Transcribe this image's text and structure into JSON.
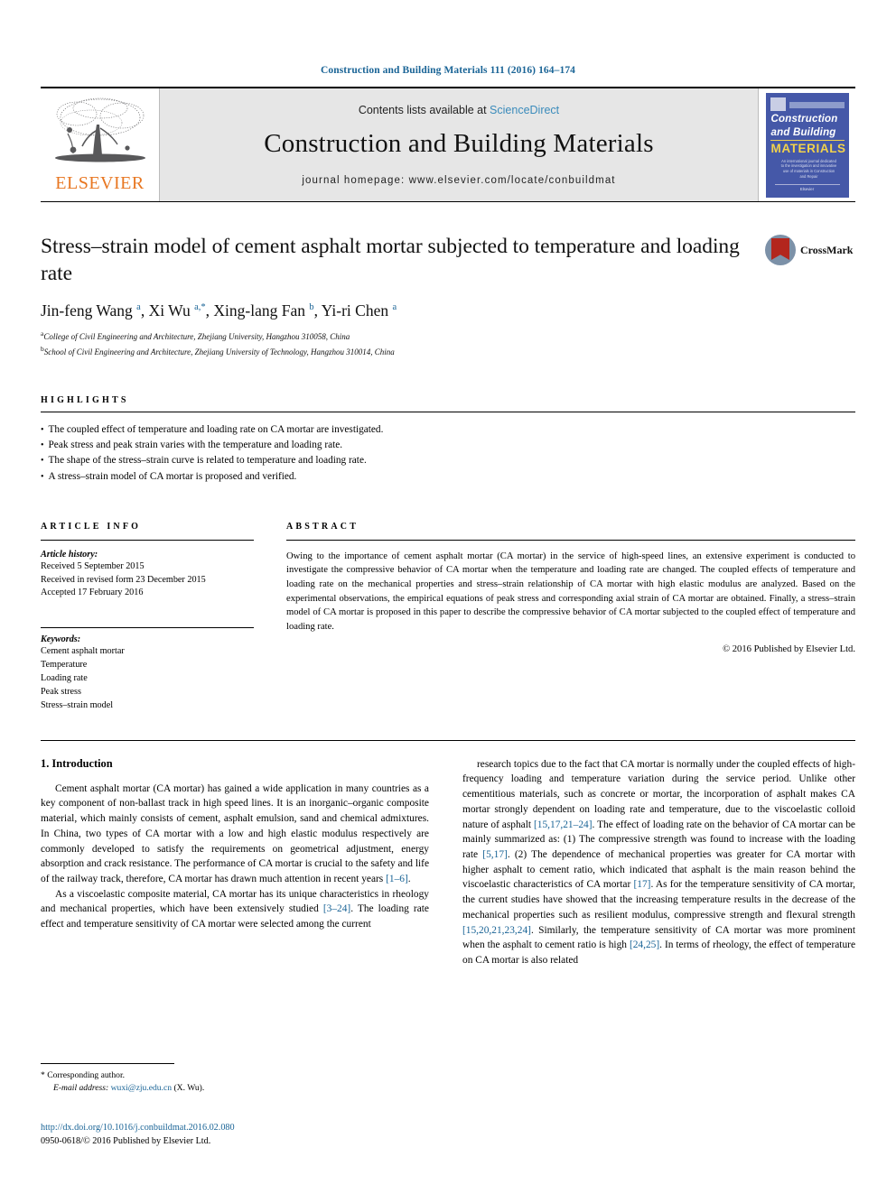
{
  "running_head": "Construction and Building Materials 111 (2016) 164–174",
  "masthead": {
    "publisher_name": "ELSEVIER",
    "contents_prefix": "Contents lists available at ",
    "contents_link": "ScienceDirect",
    "journal_title": "Construction and Building Materials",
    "journal_homepage": "journal homepage: www.elsevier.com/locate/conbuildmat",
    "cover": {
      "line1": "Construction",
      "line2": "and Building",
      "line3": "MATERIALS",
      "subtitle": "An international journal dedicated to the investigation and innovative use of materials in Construction and Repair",
      "footer": "Elsevier"
    }
  },
  "article": {
    "title": "Stress–strain model of cement asphalt mortar subjected to temperature and loading rate",
    "crossmark_label": "CrossMark",
    "authors_html": "Jin-feng Wang <sup>a</sup>, Xi Wu <sup>a,*</sup>, Xing-lang Fan <sup>b</sup>, Yi-ri Chen <sup>a</sup>",
    "affiliations": [
      "College of Civil Engineering and Architecture, Zhejiang University, Hangzhou 310058, China",
      "School of Civil Engineering and Architecture, Zhejiang University of Technology, Hangzhou 310014, China"
    ],
    "affiliation_markers": [
      "a",
      "b"
    ]
  },
  "highlights": {
    "label": "HIGHLIGHTS",
    "items": [
      "The coupled effect of temperature and loading rate on CA mortar are investigated.",
      "Peak stress and peak strain varies with the temperature and loading rate.",
      "The shape of the stress–strain curve is related to temperature and loading rate.",
      "A stress–strain model of CA mortar is proposed and verified."
    ]
  },
  "article_info": {
    "label": "ARTICLE INFO",
    "history_head": "Article history:",
    "history": [
      "Received 5 September 2015",
      "Received in revised form 23 December 2015",
      "Accepted 17 February 2016"
    ],
    "keywords_head": "Keywords:",
    "keywords": [
      "Cement asphalt mortar",
      "Temperature",
      "Loading rate",
      "Peak stress",
      "Stress–strain model"
    ]
  },
  "abstract": {
    "label": "ABSTRACT",
    "text": "Owing to the importance of cement asphalt mortar (CA mortar) in the service of high-speed lines, an extensive experiment is conducted to investigate the compressive behavior of CA mortar when the temperature and loading rate are changed. The coupled effects of temperature and loading rate on the mechanical properties and stress–strain relationship of CA mortar with high elastic modulus are analyzed. Based on the experimental observations, the empirical equations of peak stress and corresponding axial strain of CA mortar are obtained. Finally, a stress–strain model of CA mortar is proposed in this paper to describe the compressive behavior of CA mortar subjected to the coupled effect of temperature and loading rate.",
    "copyright": "© 2016 Published by Elsevier Ltd."
  },
  "body": {
    "section_title": "1. Introduction",
    "left_paragraphs_html": [
      "Cement asphalt mortar (CA mortar) has gained a wide application in many countries as a key component of non-ballast track in high speed lines. It is an inorganic–organic composite material, which mainly consists of cement, asphalt emulsion, sand and chemical admixtures. In China, two types of CA mortar with a low and high elastic modulus respectively are commonly developed to satisfy the requirements on geometrical adjustment, energy absorption and crack resistance. The performance of CA mortar is crucial to the safety and life of the railway track, therefore, CA mortar has drawn much attention in recent years <span class=\"cite\">[1–6]</span>.",
      "As a viscoelastic composite material, CA mortar has its unique characteristics in rheology and mechanical properties, which have been extensively studied <span class=\"cite\">[3–24]</span>. The loading rate effect and temperature sensitivity of CA mortar were selected among the current"
    ],
    "right_paragraphs_html": [
      "research topics due to the fact that CA mortar is normally under the coupled effects of high-frequency loading and temperature variation during the service period. Unlike other cementitious materials, such as concrete or mortar, the incorporation of asphalt makes CA mortar strongly dependent on loading rate and temperature, due to the viscoelastic colloid nature of asphalt <span class=\"cite\">[15,17,21–24]</span>. The effect of loading rate on the behavior of CA mortar can be mainly summarized as: (1) The compressive strength was found to increase with the loading rate <span class=\"cite\">[5,17]</span>. (2) The dependence of mechanical properties was greater for CA mortar with higher asphalt to cement ratio, which indicated that asphalt is the main reason behind the viscoelastic characteristics of CA mortar <span class=\"cite\">[17]</span>. As for the temperature sensitivity of CA mortar, the current studies have showed that the increasing temperature results in the decrease of the mechanical properties such as resilient modulus, compressive strength and flexural strength <span class=\"cite\">[15,20,21,23,24]</span>. Similarly, the temperature sensitivity of CA mortar was more prominent when the asphalt to cement ratio is high <span class=\"cite\">[24,25]</span>. In terms of rheology, the effect of temperature on CA mortar is also related"
    ]
  },
  "footnote": {
    "corresponding_marker": "*",
    "corresponding_text": "Corresponding author.",
    "email_label": "E-mail address:",
    "email": "wuxi@zju.edu.cn",
    "email_owner": "(X. Wu)."
  },
  "doc_footer": {
    "doi": "http://dx.doi.org/10.1016/j.conbuildmat.2016.02.080",
    "issn_line": "0950-0618/© 2016 Published by Elsevier Ltd."
  }
}
